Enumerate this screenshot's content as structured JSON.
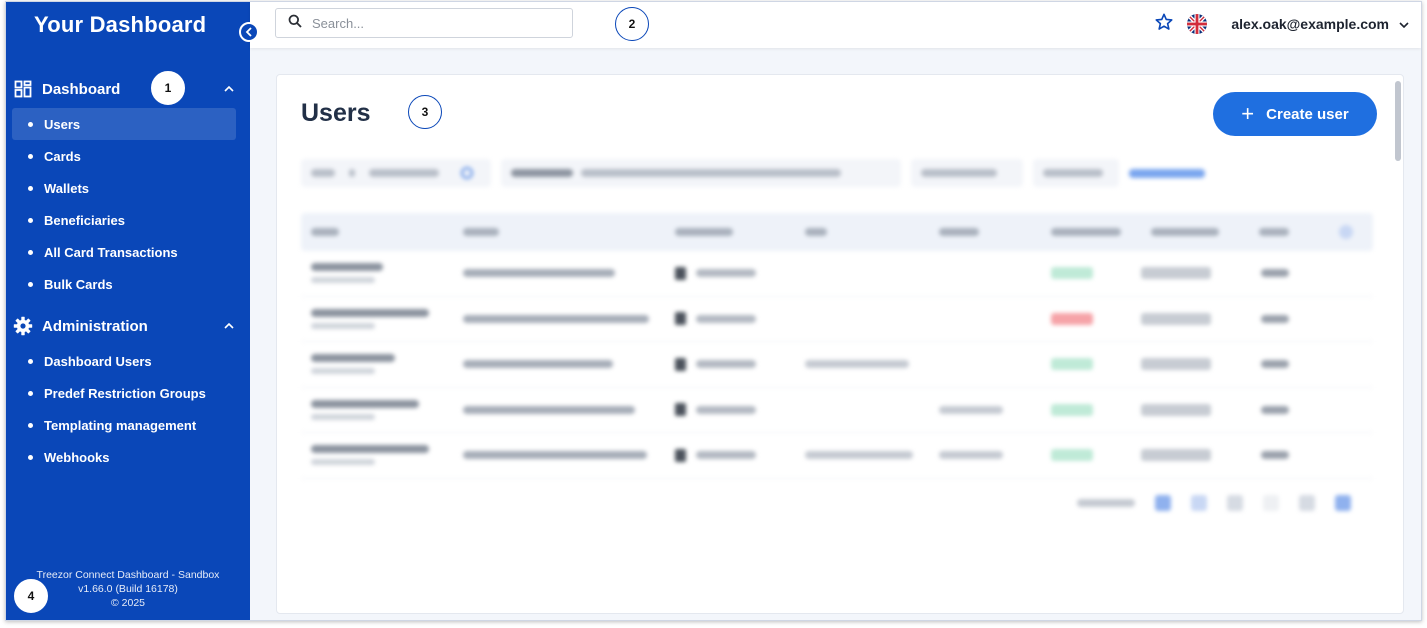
{
  "sidebar": {
    "brand": "Your Dashboard",
    "sections": [
      {
        "title": "Dashboard",
        "icon": "dashboard-grid-icon",
        "items": [
          {
            "label": "Users",
            "active": true
          },
          {
            "label": "Cards"
          },
          {
            "label": "Wallets"
          },
          {
            "label": "Beneficiaries"
          },
          {
            "label": "All Card Transactions"
          },
          {
            "label": "Bulk Cards"
          }
        ]
      },
      {
        "title": "Administration",
        "icon": "gear-icon",
        "items": [
          {
            "label": "Dashboard Users"
          },
          {
            "label": "Predef Restriction Groups"
          },
          {
            "label": "Templating management"
          },
          {
            "label": "Webhooks"
          }
        ]
      }
    ],
    "footer": {
      "line1": "Treezor Connect Dashboard - Sandbox",
      "line2": "v1.66.0 (Build 16178)",
      "line3": "© 2025"
    }
  },
  "topbar": {
    "search_placeholder": "Search...",
    "user_email": "alex.oak@example.com",
    "icons": [
      "search-icon",
      "star-icon",
      "uk-flag-icon",
      "chevron-down-icon"
    ]
  },
  "main": {
    "title": "Users",
    "create_button": "Create user"
  },
  "markers": [
    "1",
    "2",
    "3",
    "4"
  ],
  "colors": {
    "sidebar": "#0a47b8",
    "primary_button": "#1f6fe0",
    "status_active": "#bfead7",
    "status_blocked": "#f6a3a8"
  }
}
